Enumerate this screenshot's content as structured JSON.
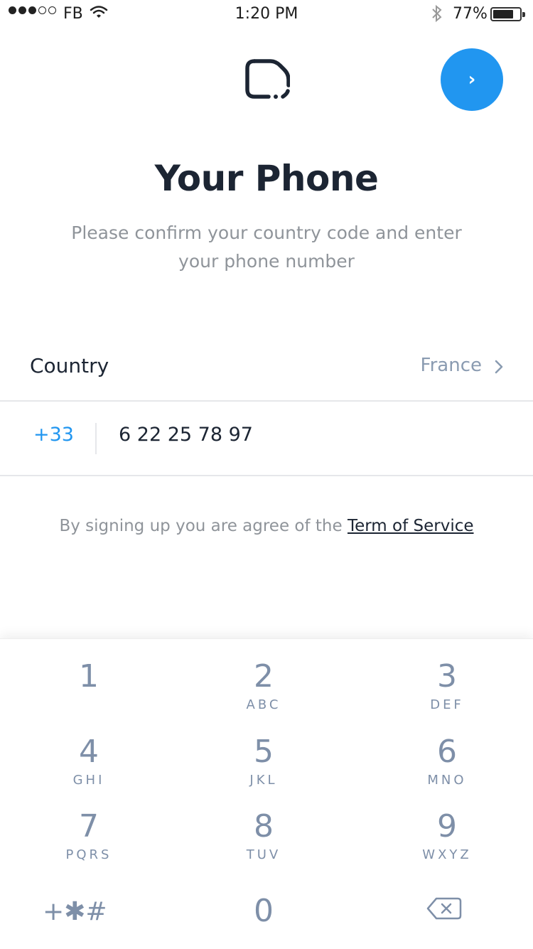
{
  "status_bar": {
    "carrier": "FB",
    "time": "1:20 PM",
    "battery_percent": "77%",
    "battery_level": 0.77,
    "signal_bars_filled": 3,
    "signal_bars_total": 5,
    "icons": [
      "signal-icon",
      "wifi-icon",
      "bluetooth-icon",
      "battery-icon"
    ]
  },
  "header": {
    "logo_icon": "app-logo-icon",
    "next_button_label": "›"
  },
  "title": "Your Phone",
  "subtitle": "Please confirm your country code and enter your phone number",
  "country": {
    "label": "Country",
    "value": "France"
  },
  "phone": {
    "code": "+33",
    "number": "6 22 25 78 97"
  },
  "terms": {
    "text": "By signing up you are agree of the ",
    "link": "Term of Service"
  },
  "keypad": {
    "keys": [
      {
        "digit": "1",
        "letters": ""
      },
      {
        "digit": "2",
        "letters": "ABC"
      },
      {
        "digit": "3",
        "letters": "DEF"
      },
      {
        "digit": "4",
        "letters": "GHI"
      },
      {
        "digit": "5",
        "letters": "JKL"
      },
      {
        "digit": "6",
        "letters": "MNO"
      },
      {
        "digit": "7",
        "letters": "PQRS"
      },
      {
        "digit": "8",
        "letters": "TUV"
      },
      {
        "digit": "9",
        "letters": "WXYZ"
      },
      {
        "digit": "0",
        "letters": ""
      }
    ],
    "special_label": "+✱#",
    "backspace_icon": "backspace-icon"
  },
  "colors": {
    "accent": "#2196f0",
    "title": "#1c2533",
    "muted": "#8f949a",
    "keypad_text": "#7e8fa8"
  }
}
